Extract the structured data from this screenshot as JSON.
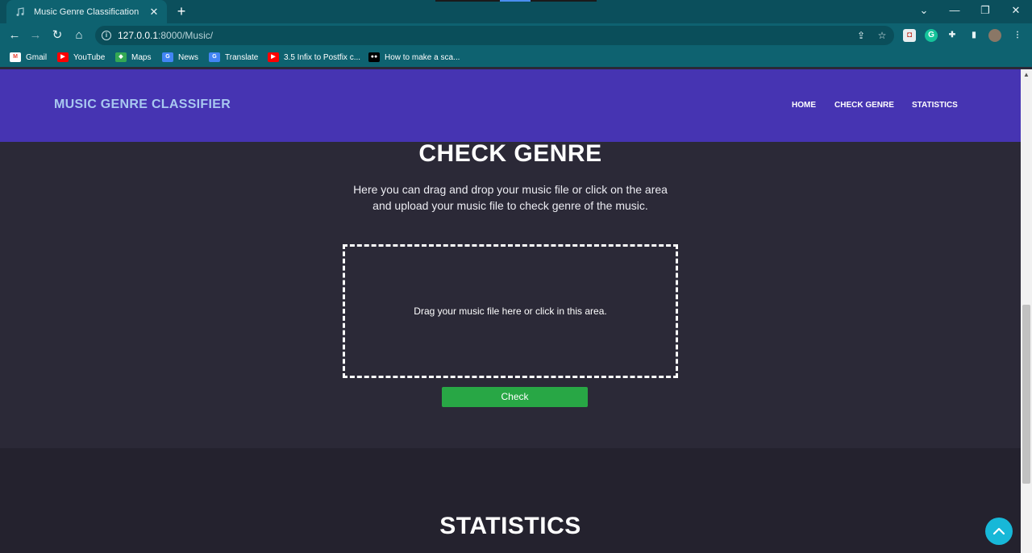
{
  "browser": {
    "tab_title": "Music Genre Classification",
    "tab_close": "✕",
    "new_tab": "+",
    "window_controls": {
      "dropdown": "⌄",
      "minimize": "—",
      "restore": "❐",
      "close": "✕"
    },
    "url_host": "127.0.0.1",
    "url_path": ":8000/Music/",
    "bookmarks": [
      {
        "label": "Gmail",
        "icon": "gmail-icon",
        "color": "#ea4335"
      },
      {
        "label": "YouTube",
        "icon": "youtube-icon",
        "color": "#ff0000"
      },
      {
        "label": "Maps",
        "icon": "maps-icon",
        "color": "#34a853"
      },
      {
        "label": "News",
        "icon": "news-icon",
        "color": "#4285f4"
      },
      {
        "label": "Translate",
        "icon": "translate-icon",
        "color": "#4285f4"
      },
      {
        "label": "3.5 Infix to Postfix c...",
        "icon": "youtube-icon",
        "color": "#ff0000"
      },
      {
        "label": "How to make a sca...",
        "icon": "medium-icon",
        "color": "#000000"
      }
    ]
  },
  "navbar": {
    "brand": "MUSIC GENRE CLASSIFIER",
    "links": [
      "HOME",
      "CHECK GENRE",
      "STATISTICS"
    ]
  },
  "check_genre": {
    "title": "CHECK GENRE",
    "intro_line1": "Here you can drag and drop your music file or click on the area",
    "intro_line2": "and upload your music file to check genre of the music.",
    "dropzone_text": "Drag your music file here or click in this area.",
    "button_label": "Check"
  },
  "statistics": {
    "title": "STATISTICS"
  },
  "colors": {
    "navbar": "#4634b2",
    "brand_text": "#a8c8f0",
    "page_bg": "#2b2937",
    "check_button": "#28a745",
    "scroll_top_button": "#17b8d8"
  }
}
